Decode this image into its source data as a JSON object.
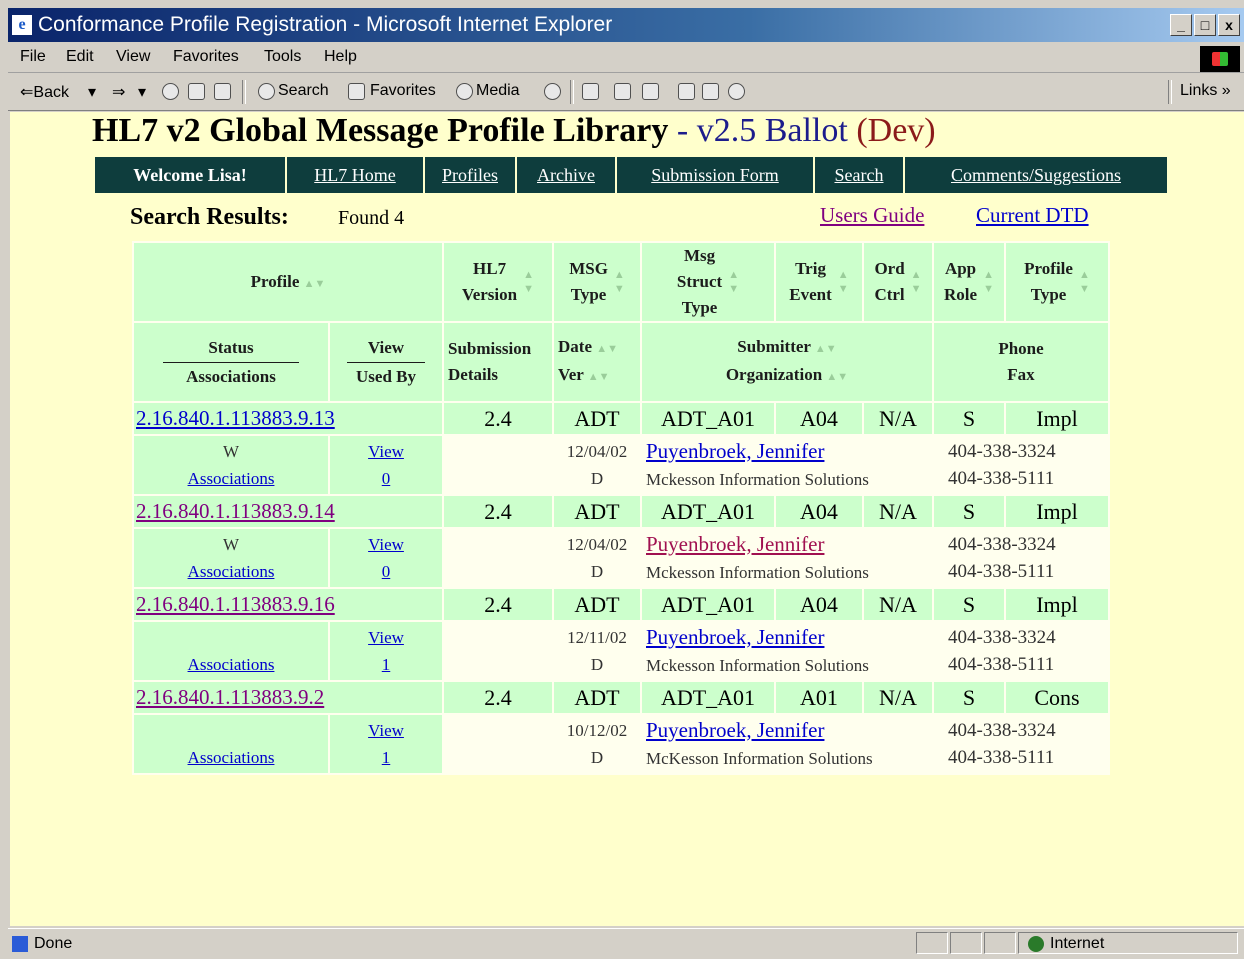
{
  "window": {
    "title": "Conformance Profile Registration - Microsoft Internet Explorer",
    "min": "_",
    "max": "□",
    "close": "x"
  },
  "menu": [
    "File",
    "Edit",
    "View",
    "Favorites",
    "Tools",
    "Help"
  ],
  "toolbar": {
    "back": "⇐Back",
    "forward": "⇒",
    "search": "Search",
    "favorites": "Favorites",
    "media": "Media",
    "links": "Links »"
  },
  "page": {
    "title_main": "HL7 v2 Global Message Profile Library",
    "title_sep": " - ",
    "title_ver": "v2.5 Ballot",
    "title_dev": "(Dev)"
  },
  "nav": {
    "welcome": "Welcome Lisa!",
    "items": [
      "HL7 Home",
      "Profiles",
      "Archive",
      "Submission Form",
      "Search",
      "Comments/Suggestions"
    ]
  },
  "results": {
    "label": "Search Results:",
    "count": "Found 4",
    "users_guide": "Users Guide",
    "current_dtd": "Current DTD"
  },
  "headers": {
    "profile": "Profile",
    "hl7_version": [
      "HL7",
      "Version"
    ],
    "msg_type": [
      "MSG",
      "Type"
    ],
    "msg_struct": [
      "Msg",
      "Struct",
      "Type"
    ],
    "trig_event": [
      "Trig",
      "Event"
    ],
    "ord_ctrl": [
      "Ord",
      "Ctrl"
    ],
    "app_role": [
      "App",
      "Role"
    ],
    "profile_type": [
      "Profile",
      "Type"
    ],
    "status": "Status",
    "associations": "Associations",
    "view": "View",
    "used_by": "Used By",
    "submission": [
      "Submission",
      "Details"
    ],
    "date": "Date",
    "ver": "Ver",
    "submitter": "Submitter",
    "organization": "Organization",
    "phone": "Phone",
    "fax": "Fax"
  },
  "rows": [
    {
      "oid": "2.16.840.1.113883.9.13",
      "hl7": "2.4",
      "msg": "ADT",
      "struct": "ADT_A01",
      "trig": "A04",
      "ord": "N/A",
      "role": "S",
      "ptype": "Impl",
      "status": "W",
      "assoc": "Associations",
      "view": "View",
      "used": "0",
      "date": "12/04/02",
      "ver": "D",
      "submitter": "Puyenbroek, Jennifer",
      "org": "Mckesson Information Solutions",
      "phone": "404-338-3324",
      "fax": "404-338-5111"
    },
    {
      "oid": "2.16.840.1.113883.9.14",
      "hl7": "2.4",
      "msg": "ADT",
      "struct": "ADT_A01",
      "trig": "A04",
      "ord": "N/A",
      "role": "S",
      "ptype": "Impl",
      "status": "W",
      "assoc": "Associations",
      "view": "View",
      "used": "0",
      "date": "12/04/02",
      "ver": "D",
      "submitter": "Puyenbroek, Jennifer",
      "org": "Mckesson Information Solutions",
      "phone": "404-338-3324",
      "fax": "404-338-5111"
    },
    {
      "oid": "2.16.840.1.113883.9.16",
      "hl7": "2.4",
      "msg": "ADT",
      "struct": "ADT_A01",
      "trig": "A04",
      "ord": "N/A",
      "role": "S",
      "ptype": "Impl",
      "status": "",
      "assoc": "Associations",
      "view": "View",
      "used": "1",
      "date": "12/11/02",
      "ver": "D",
      "submitter": "Puyenbroek, Jennifer",
      "org": "Mckesson Information Solutions",
      "phone": "404-338-3324",
      "fax": "404-338-5111"
    },
    {
      "oid": "2.16.840.1.113883.9.2",
      "hl7": "2.4",
      "msg": "ADT",
      "struct": "ADT_A01",
      "trig": "A01",
      "ord": "N/A",
      "role": "S",
      "ptype": "Cons",
      "status": "",
      "assoc": "Associations",
      "view": "View",
      "used": "1",
      "date": "10/12/02",
      "ver": "D",
      "submitter": "Puyenbroek, Jennifer",
      "org": "McKesson Information Solutions",
      "phone": "404-338-3324",
      "fax": "404-338-5111"
    }
  ],
  "status": {
    "done": "Done",
    "zone": "Internet"
  }
}
